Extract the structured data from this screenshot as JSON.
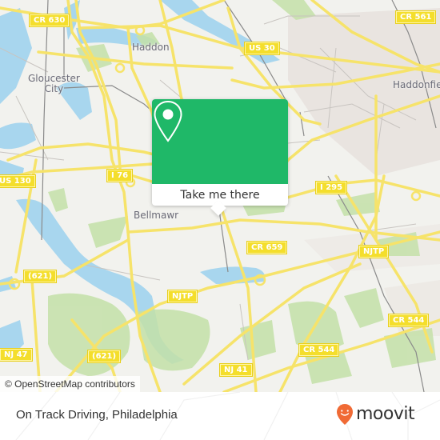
{
  "map": {
    "colors": {
      "land": "#f2f2ee",
      "water": "#a8d6ee",
      "park": "#c4e1a8",
      "urban": "#e9e4e0",
      "road": "#f6e36a",
      "road_casing": "#e8cf3c",
      "minor_road": "#c8c4c0",
      "rail": "#8a8a8a"
    },
    "road_labels": [
      {
        "text": "CR 630"
      },
      {
        "text": "US 30"
      },
      {
        "text": "CR 561"
      },
      {
        "text": "I 76"
      },
      {
        "text": "US 130"
      },
      {
        "text": "I 295"
      },
      {
        "text": "CR 659"
      },
      {
        "text": "NJTP"
      },
      {
        "text": "(621)"
      },
      {
        "text": "NJTP"
      },
      {
        "text": "CR 544"
      },
      {
        "text": "NJ 47"
      },
      {
        "text": "(621)"
      },
      {
        "text": "CR 544"
      },
      {
        "text": "NJ 41"
      }
    ],
    "place_labels": [
      {
        "text": "Haddon"
      },
      {
        "text": "Gloucester\nCity"
      },
      {
        "text": "Haddonfie"
      },
      {
        "text": "Bellmawr"
      }
    ],
    "attribution": "© OpenStreetMap contributors"
  },
  "popup": {
    "accent_color": "#1fb868",
    "icon": "map-pin-icon",
    "button_label": "Take me there"
  },
  "footer": {
    "title": "On Track Driving, Philadelphia",
    "brand": {
      "name": "moovit",
      "icon": "moovit-smile-pin-icon",
      "color": "#f06a35"
    }
  }
}
